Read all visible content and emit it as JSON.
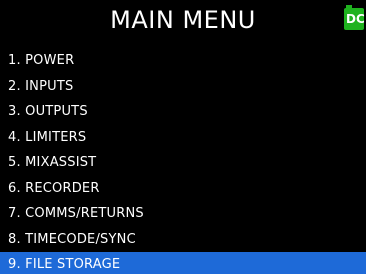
{
  "header": {
    "title": "MAIN MENU",
    "battery_label": "DC"
  },
  "menu": {
    "items": [
      {
        "label": "1. POWER"
      },
      {
        "label": "2. INPUTS"
      },
      {
        "label": "3. OUTPUTS"
      },
      {
        "label": "4. LIMITERS"
      },
      {
        "label": "5. MIXASSIST"
      },
      {
        "label": "6. RECORDER"
      },
      {
        "label": "7. COMMS/RETURNS"
      },
      {
        "label": "8. TIMECODE/SYNC"
      },
      {
        "label": "9. FILE STORAGE"
      }
    ],
    "selected_index": 8
  },
  "colors": {
    "background": "#000000",
    "text": "#ffffff",
    "selection": "#1e6ad8",
    "battery": "#1fb21f"
  },
  "icons": {
    "battery": "battery-dc-icon"
  }
}
